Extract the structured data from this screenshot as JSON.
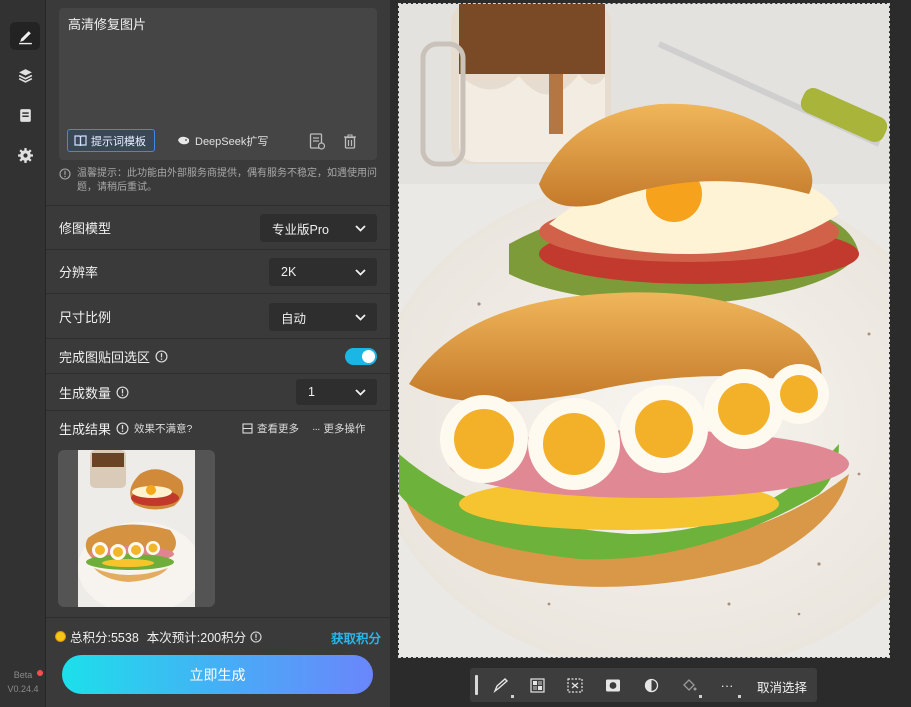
{
  "sidebar": {
    "items": [
      {
        "icon": "brush-icon",
        "active": true
      },
      {
        "icon": "layers-icon",
        "active": false
      },
      {
        "icon": "clipboard-icon",
        "active": false
      },
      {
        "icon": "gear-icon",
        "active": false
      }
    ],
    "beta": "Beta",
    "version": "V0.24.4"
  },
  "prompt": {
    "text": "高清修复图片",
    "template_label": "提示词模板",
    "deepseek_label": "DeepSeek扩写",
    "notice": "温馨提示：此功能由外部服务商提供，偶有服务不稳定，如遇使用问题，请稍后重试。"
  },
  "settings": {
    "model_label": "修图模型",
    "model_value": "专业版Pro",
    "resolution_label": "分辨率",
    "resolution_value": "2K",
    "ratio_label": "尺寸比例",
    "ratio_value": "自动",
    "paste_back_label": "完成图贴回选区",
    "paste_back_on": true,
    "count_label": "生成数量",
    "count_value": "1"
  },
  "results": {
    "label": "生成结果",
    "unsatisfied": "效果不满意?",
    "view_more": "查看更多",
    "more_actions": "更多操作"
  },
  "footer": {
    "total_points": "总积分:5538",
    "estimate": "本次预计:200积分",
    "get_points": "获取积分",
    "generate": "立即生成"
  },
  "toolbar": {
    "cancel_selection": "取消选择"
  },
  "colors": {
    "accent": "#28b6ee",
    "panel": "#3a3a3a",
    "background": "#2b2b2b"
  }
}
